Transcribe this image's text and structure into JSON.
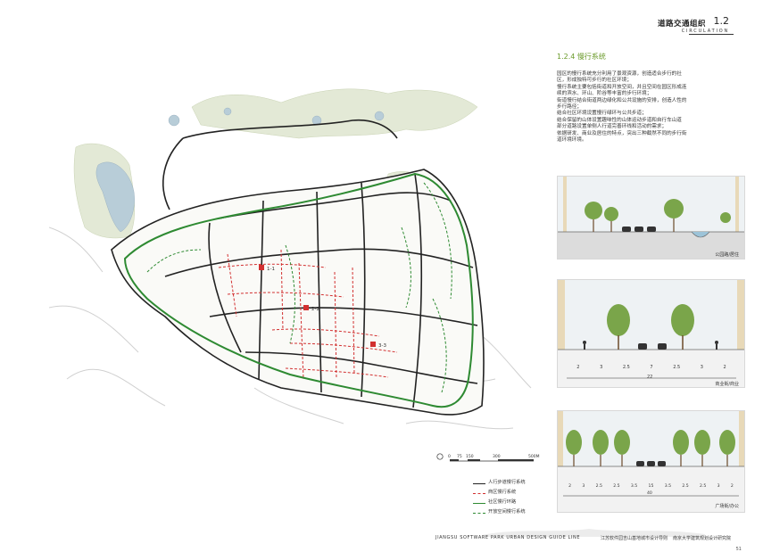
{
  "header": {
    "title": "道路交通组织",
    "number": "1.2",
    "subtitle": "CIRCULATION"
  },
  "section": {
    "title": "1.2.4 慢行系统",
    "paragraph_lines": [
      "园区的慢行系统充分利用了景观资源，创造适合步行的社",
      "区，形成独特可步行的社区环境；",
      "慢行系统主要包括街道和开放空间，并且空间在园区形成连",
      "续的滨水、环山、阶谷等丰富的步行环境；",
      "街道慢行结合街道两边绿化和公共设施的安排，创造人性的",
      "步行路径；",
      "结合社区环境设置慢行绿环与公共步道；",
      "结合保留的山体设置趣味性的山体运动步道和自行车山道",
      "部分道路设置单侧人行道完善环线和活动的需求；",
      "依据研发、商业及居住的特点，突出三种截然不同的步行街",
      "道环境环境。"
    ]
  },
  "sections": [
    {
      "caption": "公园路/居住"
    },
    {
      "caption": "商业街/商业",
      "dims": [
        "2",
        "3",
        "2.5",
        "7",
        "2.5",
        "3",
        "2"
      ],
      "total": "22"
    },
    {
      "caption": "广场街/办公",
      "dims": [
        "2",
        "3",
        "2.5",
        "2.5",
        "3.5",
        "15",
        "3.5",
        "2.5",
        "2.5",
        "3",
        "2"
      ],
      "total": "40"
    }
  ],
  "plan": {
    "labels": [
      "1-1",
      "2-2",
      "3-3"
    ]
  },
  "legend": [
    {
      "label": "人行步道慢行系统",
      "color": "#222222",
      "style": "solid"
    },
    {
      "label": "商区慢行系统",
      "color": "#d23030",
      "style": "dashed"
    },
    {
      "label": "社区慢行环路",
      "color": "#2e8a32",
      "style": "solid"
    },
    {
      "label": "开放空间慢行系统",
      "color": "#2e8a32",
      "style": "dashed"
    }
  ],
  "scale_bar": {
    "ticks": [
      "0",
      "75",
      "150",
      "300",
      "500M"
    ]
  },
  "footer": {
    "english": "JIANGSU SOFTWARE PARK URBAN DESIGN GUIDE LINE",
    "org1": "江苏软件园吉山基地城市设计导则",
    "org2": "南京大学建筑规划设计研究院",
    "page": "51"
  },
  "colors": {
    "accent": "#6a9a2a",
    "road": "#222222",
    "commercial_path": "#d23030",
    "green_path": "#2e8a32",
    "water": "#b8cdd8",
    "greenery": "#d9e3c6"
  }
}
